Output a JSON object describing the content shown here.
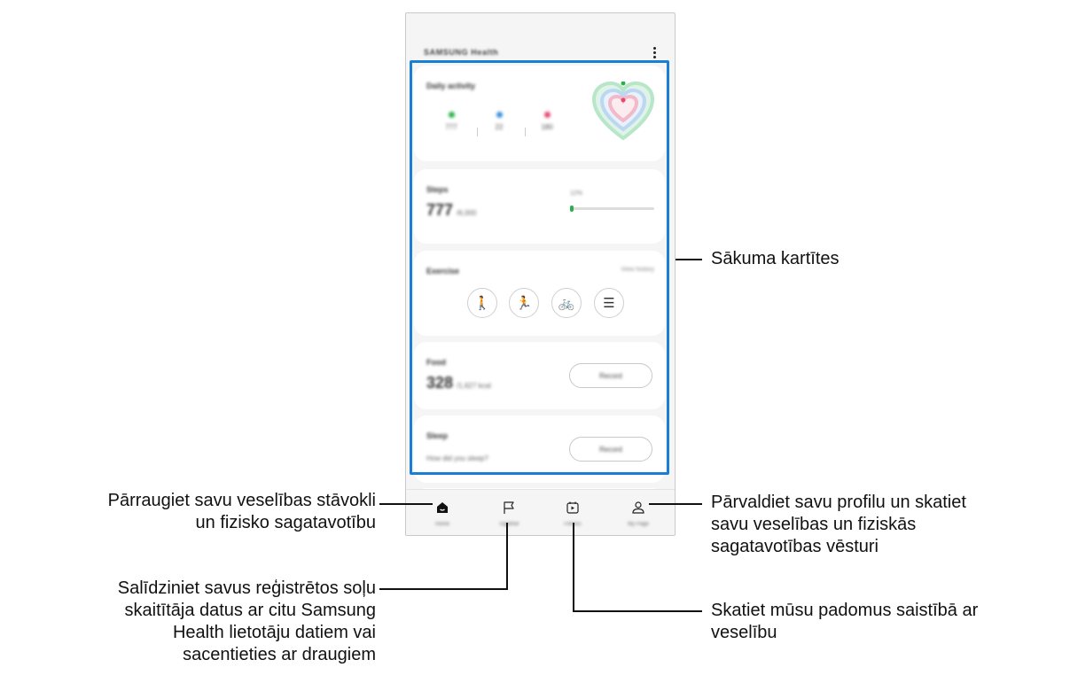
{
  "app": {
    "title": "SAMSUNG Health",
    "more_icon": "more-vertical-icon"
  },
  "cards": {
    "daily": {
      "title": "Daily activity",
      "metrics": [
        {
          "value": "777",
          "color": "#2ab14b",
          "icon": "steps-icon"
        },
        {
          "value": "22",
          "color": "#3a8fdc",
          "icon": "active-time-icon"
        },
        {
          "value": "180",
          "color": "#e8456f",
          "icon": "calories-icon"
        }
      ],
      "heart_colors": [
        "#b7e6c9",
        "#bcd7f2",
        "#f3b8c9"
      ]
    },
    "steps": {
      "title": "Steps",
      "value": "777",
      "goal": "/6,000",
      "progress_label": "12%",
      "progress": 0.12
    },
    "exercise": {
      "title": "Exercise",
      "view_history": "View history",
      "buttons": [
        {
          "icon": "walking-icon",
          "glyph": "🚶"
        },
        {
          "icon": "running-icon",
          "glyph": "🏃"
        },
        {
          "icon": "cycling-icon",
          "glyph": "🚲"
        },
        {
          "icon": "list-icon",
          "glyph": "☰"
        }
      ]
    },
    "food": {
      "title": "Food",
      "value": "328",
      "goal": "/1,627 kcal",
      "record": "Record"
    },
    "sleep": {
      "title": "Sleep",
      "question": "How did you sleep?",
      "record": "Record"
    }
  },
  "nav": [
    {
      "label": "Home",
      "icon": "home-icon"
    },
    {
      "label": "Together",
      "icon": "flag-icon"
    },
    {
      "label": "Fitness",
      "icon": "calendar-play-icon"
    },
    {
      "label": "My Page",
      "icon": "person-icon"
    }
  ],
  "callouts": {
    "home_cards": "Sākuma kartītes",
    "home": [
      "Pārraugiet savu veselības stāvokli",
      "un fizisko sagatavotību"
    ],
    "together": [
      "Salīdziniet savus reģistrētos soļu",
      "skaitītāja datus ar citu Samsung",
      "Health lietotāju datiem vai",
      "sacentieties ar draugiem"
    ],
    "fitness": [
      "Skatiet mūsu padomus saistībā ar",
      "veselību"
    ],
    "my_page": [
      "Pārvaldiet savu profilu un skatiet",
      "savu veselības un fiziskās",
      "sagatavotības vēsturi"
    ]
  },
  "colors": {
    "highlight": "#1a7fd4",
    "accent_green": "#2ab14b",
    "accent_blue": "#3a8fdc",
    "accent_pink": "#e8456f"
  }
}
